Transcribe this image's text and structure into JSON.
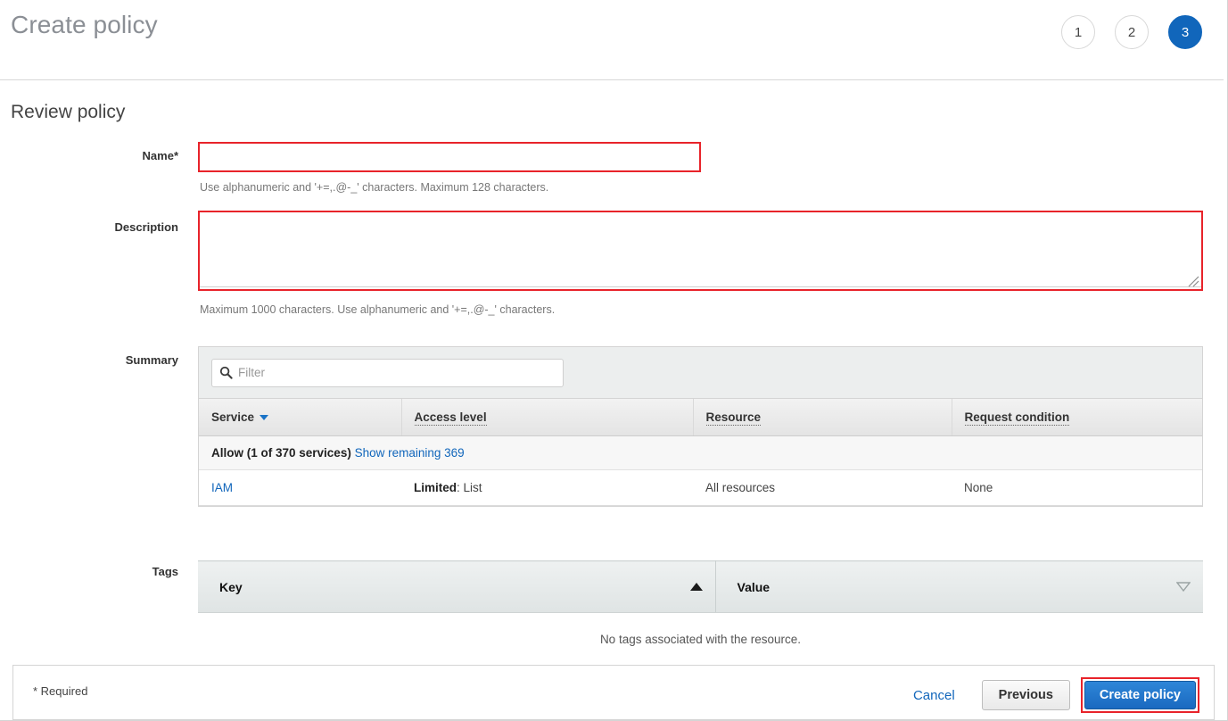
{
  "header": {
    "title": "Create policy",
    "steps": [
      {
        "number": "1",
        "state": "inactive"
      },
      {
        "number": "2",
        "state": "inactive"
      },
      {
        "number": "3",
        "state": "active"
      }
    ],
    "active_step_color": "#1166bb"
  },
  "section": {
    "title": "Review policy"
  },
  "name_field": {
    "label": "Name*",
    "value": "",
    "placeholder": "",
    "hint": "Use alphanumeric and '+=,.@-_' characters. Maximum 128 characters.",
    "highlight_color": "#e8232a"
  },
  "description_field": {
    "label": "Description",
    "value": "",
    "placeholder": "",
    "hint": "Maximum 1000 characters. Use alphanumeric and '+=,.@-_' characters.",
    "highlight_color": "#e8232a"
  },
  "summary": {
    "label": "Summary",
    "filter": {
      "value": "",
      "placeholder": "Filter"
    },
    "columns": [
      "Service",
      "Access level",
      "Resource",
      "Request condition"
    ],
    "sorted_column": "Service",
    "group_row": {
      "title": "Allow (1 of 370 services)",
      "show_remaining_link": "Show remaining 369"
    },
    "rows": [
      {
        "service": "IAM",
        "access_level_prefix": "Limited",
        "access_level_value": ": List",
        "resource": "All resources",
        "request_condition": "None"
      }
    ]
  },
  "tags": {
    "label": "Tags",
    "columns": [
      "Key",
      "Value"
    ],
    "empty_message": "No tags associated with the resource."
  },
  "footer": {
    "required_note": "* Required",
    "cancel_label": "Cancel",
    "previous_label": "Previous",
    "create_label": "Create policy",
    "create_highlight_color": "#e8232a",
    "accent_color": "#1166bb"
  }
}
